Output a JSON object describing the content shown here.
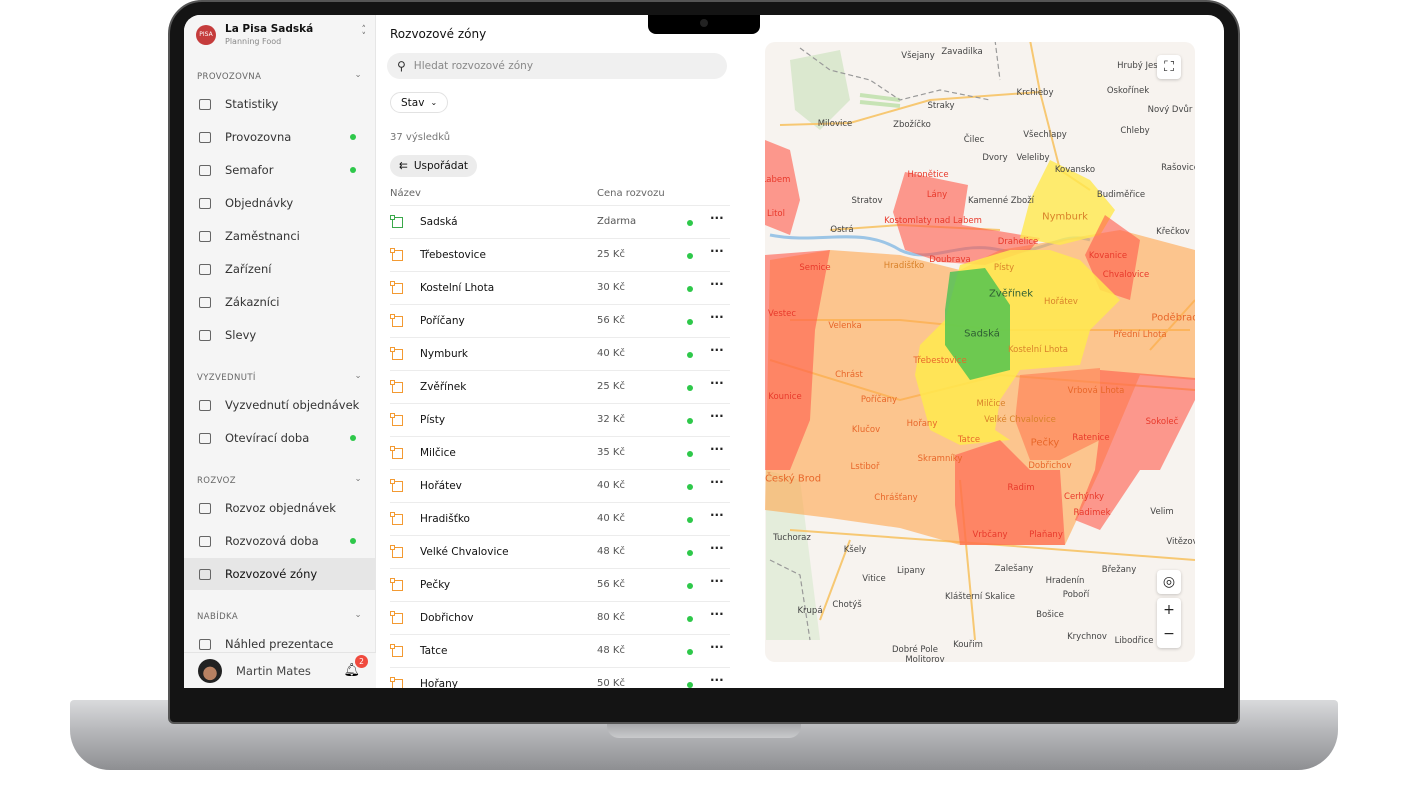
{
  "brand": {
    "name": "La Pisa Sadská",
    "subtitle": "Planning Food",
    "logo_text": "PISA"
  },
  "sidebar": {
    "sections": [
      {
        "label": "PROVOZOVNA",
        "items": [
          {
            "label": "Statistiky",
            "icon": "chart-icon",
            "dot": false
          },
          {
            "label": "Provozovna",
            "icon": "store-icon",
            "dot": true
          },
          {
            "label": "Semafor",
            "icon": "traffic-light-icon",
            "dot": true
          },
          {
            "label": "Objednávky",
            "icon": "bag-icon",
            "dot": false
          },
          {
            "label": "Zaměstnanci",
            "icon": "id-card-icon",
            "dot": false
          },
          {
            "label": "Zařízení",
            "icon": "devices-icon",
            "dot": false
          },
          {
            "label": "Zákazníci",
            "icon": "users-icon",
            "dot": false
          },
          {
            "label": "Slevy",
            "icon": "percent-icon",
            "dot": false
          }
        ]
      },
      {
        "label": "VYZVEDNUTÍ",
        "items": [
          {
            "label": "Vyzvednutí objednávek",
            "icon": "walking-icon",
            "dot": false
          },
          {
            "label": "Otevírací doba",
            "icon": "door-icon",
            "dot": true
          }
        ]
      },
      {
        "label": "ROZVOZ",
        "items": [
          {
            "label": "Rozvoz objednávek",
            "icon": "car-icon",
            "dot": false
          },
          {
            "label": "Rozvozová doba",
            "icon": "car-clock-icon",
            "dot": true
          },
          {
            "label": "Rozvozové zóny",
            "icon": "zone-icon",
            "dot": false,
            "active": true
          }
        ]
      },
      {
        "label": "NABÍDKA",
        "items": [
          {
            "label": "Náhled prezentace",
            "icon": "book-icon",
            "dot": false
          }
        ]
      }
    ],
    "user": {
      "name": "Martin Mates",
      "notifications": "2"
    }
  },
  "list": {
    "title": "Rozvozové zóny",
    "search_placeholder": "Hledat rozvozové zóny",
    "filter_label": "Stav",
    "results": "37 výsledků",
    "sort_label": "Uspořádat",
    "col_name": "Název",
    "col_price": "Cena rozvozu",
    "rows": [
      {
        "name": "Sadská",
        "price": "Zdarma",
        "zone_color": "green",
        "active": true
      },
      {
        "name": "Třebestovice",
        "price": "25 Kč",
        "zone_color": "orange",
        "active": true
      },
      {
        "name": "Kostelní Lhota",
        "price": "30 Kč",
        "zone_color": "orange",
        "active": true
      },
      {
        "name": "Poříčany",
        "price": "56 Kč",
        "zone_color": "orange",
        "active": true
      },
      {
        "name": "Nymburk",
        "price": "40 Kč",
        "zone_color": "orange",
        "active": true
      },
      {
        "name": "Zvěřínek",
        "price": "25 Kč",
        "zone_color": "orange",
        "active": true
      },
      {
        "name": "Písty",
        "price": "32 Kč",
        "zone_color": "orange",
        "active": true
      },
      {
        "name": "Milčice",
        "price": "35 Kč",
        "zone_color": "orange",
        "active": true
      },
      {
        "name": "Hořátev",
        "price": "40 Kč",
        "zone_color": "orange",
        "active": true
      },
      {
        "name": "Hradišťko",
        "price": "40 Kč",
        "zone_color": "orange",
        "active": true
      },
      {
        "name": "Velké Chvalovice",
        "price": "48 Kč",
        "zone_color": "orange",
        "active": true
      },
      {
        "name": "Pečky",
        "price": "56 Kč",
        "zone_color": "orange",
        "active": true
      },
      {
        "name": "Dobřichov",
        "price": "80 Kč",
        "zone_color": "orange",
        "active": true
      },
      {
        "name": "Tatce",
        "price": "48 Kč",
        "zone_color": "orange",
        "active": true
      },
      {
        "name": "Hořany",
        "price": "50 Kč",
        "zone_color": "orange",
        "active": true
      }
    ]
  },
  "map": {
    "zone_colors": {
      "free": "#4cc85a",
      "low": "#ffe94d",
      "mid": "#ffa64d",
      "high": "#ff5a4a"
    },
    "labels": [
      "Všejany",
      "Zavadilka",
      "Hrubý Jese",
      "Milovice",
      "Straky",
      "Krchleby",
      "Oskořínek",
      "Nový Dvůr",
      "Zbožíčko",
      "Čilec",
      "Všechlapy",
      "Chleby",
      "Dvory",
      "Veleliby",
      "Kovansko",
      "Rašovice",
      "Stratov",
      "Kamenné Zboží",
      "Budiměřice",
      "Ostrá",
      "Křečkov",
      "Velim",
      "Vitězov",
      "Kšely",
      "Lipany",
      "Zalešany",
      "Břežany",
      "Vitice",
      "Hradenín",
      "Klášterní Skalice",
      "Poboří",
      "Chotýš",
      "Krupá",
      "Bošice",
      "Krychnov",
      "Libodřice",
      "Kouřim",
      "Dobré Pole",
      "Molitorov",
      "Tuchoraz",
      "Hronětice",
      "Lány",
      "Kostomlaty nad Labem",
      "Labem",
      "Litol",
      "Drahelice",
      "Nymburk",
      "Doubrava",
      "Hradišťko",
      "Semice",
      "Písty",
      "Kovanice",
      "Chvalovice",
      "Zvěřínek",
      "Hořátev",
      "Sadská",
      "Poděbrady",
      "Vestec",
      "Velenka",
      "Přední Lhota",
      "Kostelní Lhota",
      "Třebestovice",
      "Chrást",
      "Vrbová Lhota",
      "Kounice",
      "Poříčany",
      "Milčice",
      "Sokoleč",
      "Velké Chvalovice",
      "Hořany",
      "Klučov",
      "Tatce",
      "Pečky",
      "Ratenice",
      "Skramníky",
      "Lstiboř",
      "Dobřichov",
      "Český Brod",
      "Radim",
      "Cerhýnky",
      "Chrášťany",
      "Radimek",
      "Vrbčany",
      "Plaňany"
    ]
  }
}
